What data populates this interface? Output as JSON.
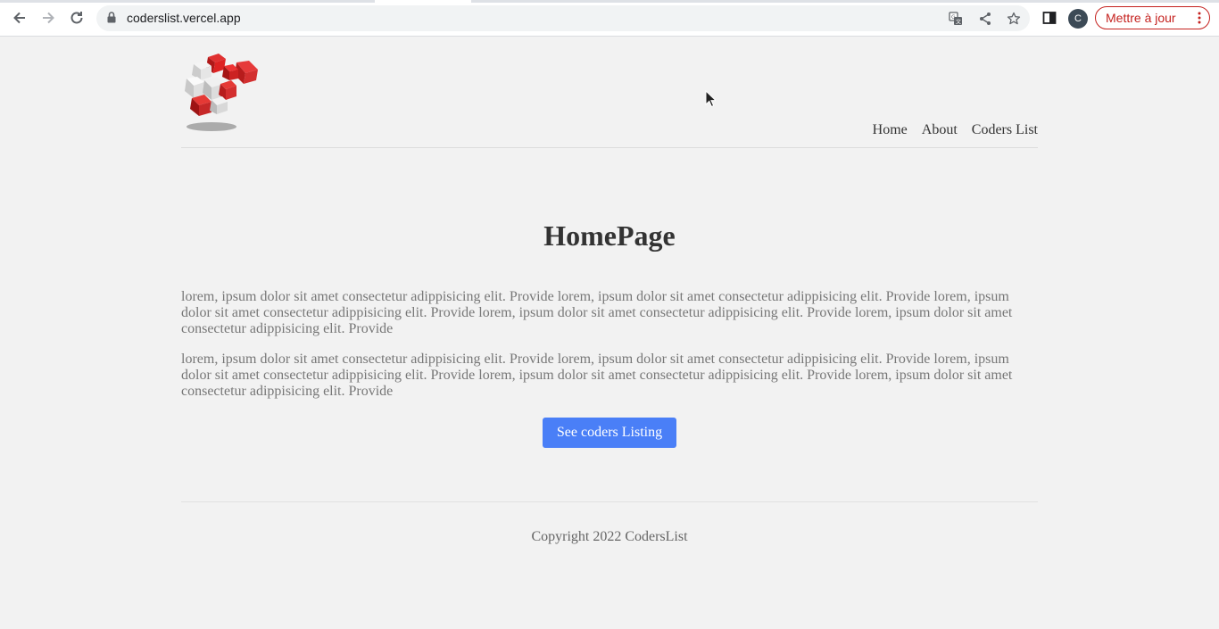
{
  "browser": {
    "url": "coderslist.vercel.app",
    "profile_initial": "C",
    "update_label": "Mettre à jour"
  },
  "header": {
    "logo_icon": "red-cubes-logo",
    "nav": [
      "Home",
      "About",
      "Coders List"
    ]
  },
  "main": {
    "title": "HomePage",
    "paragraphs": [
      "lorem, ipsum dolor sit amet consectetur adippisicing elit. Provide lorem, ipsum dolor sit amet consectetur adippisicing elit. Provide lorem, ipsum dolor sit amet consectetur adippisicing elit. Provide lorem, ipsum dolor sit amet consectetur adippisicing elit. Provide lorem, ipsum dolor sit amet consectetur adippisicing elit. Provide",
      "lorem, ipsum dolor sit amet consectetur adippisicing elit. Provide lorem, ipsum dolor sit amet consectetur adippisicing elit. Provide lorem, ipsum dolor sit amet consectetur adippisicing elit. Provide lorem, ipsum dolor sit amet consectetur adippisicing elit. Provide lorem, ipsum dolor sit amet consectetur adippisicing elit. Provide"
    ],
    "cta_label": "See coders Listing"
  },
  "footer": {
    "copyright": "Copyright 2022 CodersList"
  },
  "colors": {
    "accent": "#4a7ff7",
    "page_bg": "#f2f2f2",
    "update": "#c5221f"
  }
}
